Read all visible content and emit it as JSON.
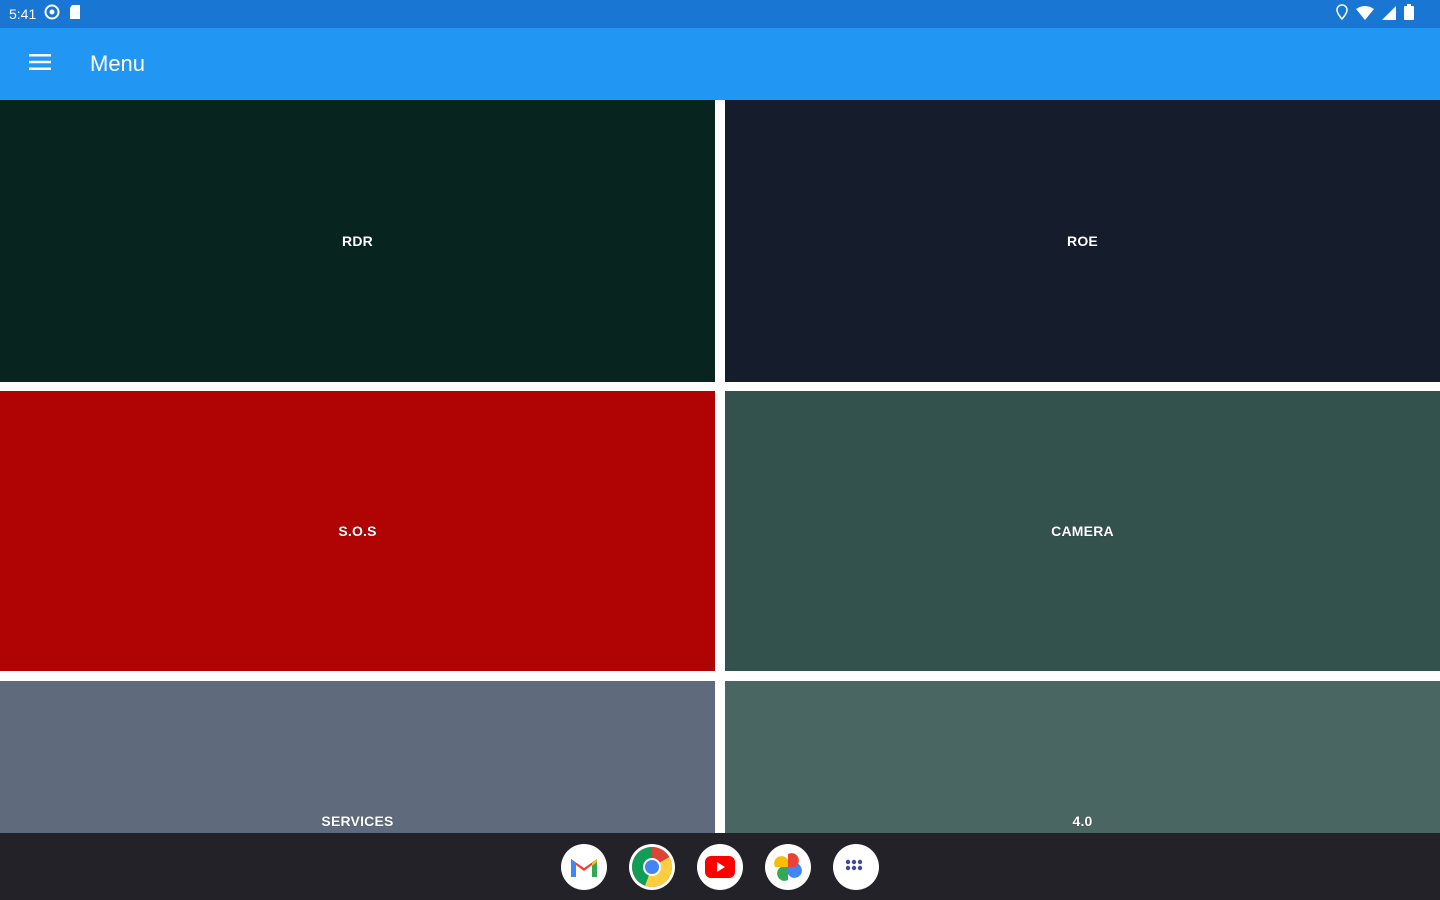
{
  "status_bar": {
    "time": "5:41",
    "icons": [
      "circle-icon",
      "sd-card-icon",
      "location-icon",
      "wifi-icon",
      "signal-icon",
      "battery-icon"
    ]
  },
  "app_bar": {
    "title": "Menu",
    "menu_icon": "hamburger-icon",
    "background": "#2196f3"
  },
  "tiles": [
    {
      "label": "RDR",
      "color": "#07241f"
    },
    {
      "label": "ROE",
      "color": "#151c2c"
    },
    {
      "label": "S.O.S",
      "color": "#b00404"
    },
    {
      "label": "CAMERA",
      "color": "#33524e"
    },
    {
      "label": "SERVICES",
      "color": "#5f6b7c"
    },
    {
      "label": "4.0",
      "color": "#4a6662"
    }
  ],
  "dock": {
    "apps": [
      "gmail-icon",
      "chrome-icon",
      "youtube-icon",
      "photos-icon",
      "app-drawer-icon"
    ]
  }
}
